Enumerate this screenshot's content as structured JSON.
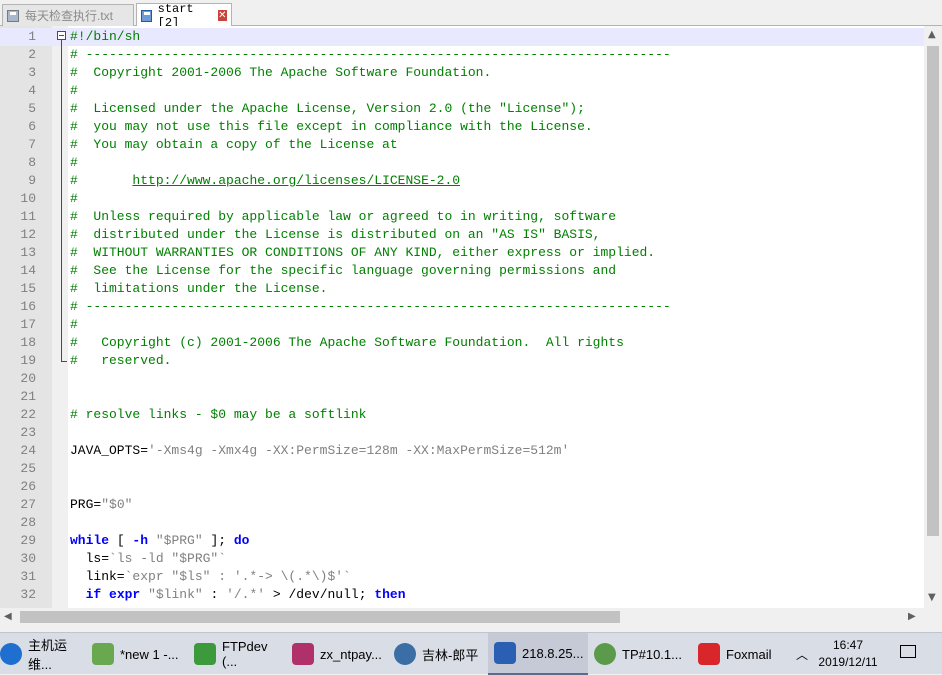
{
  "tabs": [
    {
      "label": "每天检查执行.txt",
      "active": false
    },
    {
      "label": "start [2]",
      "active": true
    }
  ],
  "editor": {
    "current_line": 1,
    "lines": [
      {
        "n": "1",
        "parts": [
          [
            "#!/bin/sh",
            "c"
          ]
        ]
      },
      {
        "n": "2",
        "parts": [
          [
            "# ---------------------------------------------------------------------------",
            "c"
          ]
        ]
      },
      {
        "n": "3",
        "parts": [
          [
            "#  Copyright 2001-2006 The Apache Software Foundation.",
            "c"
          ]
        ]
      },
      {
        "n": "4",
        "parts": [
          [
            "#",
            "c"
          ]
        ]
      },
      {
        "n": "5",
        "parts": [
          [
            "#  Licensed under the Apache License, Version 2.0 (the \"License\");",
            "c"
          ]
        ]
      },
      {
        "n": "6",
        "parts": [
          [
            "#  you may not use this file except in compliance with the License.",
            "c"
          ]
        ]
      },
      {
        "n": "7",
        "parts": [
          [
            "#  You may obtain a copy of the License at",
            "c"
          ]
        ]
      },
      {
        "n": "8",
        "parts": [
          [
            "#",
            "c"
          ]
        ]
      },
      {
        "n": "9",
        "parts": [
          [
            "#       ",
            "c"
          ],
          [
            "http://www.apache.org/licenses/LICENSE-2.0",
            "u"
          ]
        ]
      },
      {
        "n": "10",
        "parts": [
          [
            "#",
            "c"
          ]
        ]
      },
      {
        "n": "11",
        "parts": [
          [
            "#  Unless required by applicable law or agreed to in writing, software",
            "c"
          ]
        ]
      },
      {
        "n": "12",
        "parts": [
          [
            "#  distributed under the License is distributed on an \"AS IS\" BASIS,",
            "c"
          ]
        ]
      },
      {
        "n": "13",
        "parts": [
          [
            "#  WITHOUT WARRANTIES OR CONDITIONS OF ANY KIND, either express or implied.",
            "c"
          ]
        ]
      },
      {
        "n": "14",
        "parts": [
          [
            "#  See the License for the specific language governing permissions and",
            "c"
          ]
        ]
      },
      {
        "n": "15",
        "parts": [
          [
            "#  limitations under the License.",
            "c"
          ]
        ]
      },
      {
        "n": "16",
        "parts": [
          [
            "# ---------------------------------------------------------------------------",
            "c"
          ]
        ]
      },
      {
        "n": "17",
        "parts": [
          [
            "#",
            "c"
          ]
        ]
      },
      {
        "n": "18",
        "parts": [
          [
            "#   Copyright (c) 2001-2006 The Apache Software Foundation.  All rights",
            "c"
          ]
        ]
      },
      {
        "n": "19",
        "parts": [
          [
            "#   reserved.",
            "c"
          ]
        ]
      },
      {
        "n": "20",
        "parts": []
      },
      {
        "n": "21",
        "parts": []
      },
      {
        "n": "22",
        "parts": [
          [
            "# resolve links - $0 may be a softlink",
            "c"
          ]
        ]
      },
      {
        "n": "23",
        "parts": []
      },
      {
        "n": "24",
        "parts": [
          [
            "JAVA_OPTS=",
            ""
          ],
          [
            "'-Xms4g -Xmx4g -XX:PermSize=128m -XX:MaxPermSize=512m'",
            "s"
          ]
        ]
      },
      {
        "n": "25",
        "parts": []
      },
      {
        "n": "26",
        "parts": []
      },
      {
        "n": "27",
        "parts": [
          [
            "PRG=",
            ""
          ],
          [
            "\"$0\"",
            "s"
          ]
        ]
      },
      {
        "n": "28",
        "parts": []
      },
      {
        "n": "29",
        "parts": [
          [
            "while",
            "k"
          ],
          [
            " [ ",
            ""
          ],
          [
            "-h",
            "k"
          ],
          [
            " ",
            ""
          ],
          [
            "\"$PRG\"",
            "s"
          ],
          [
            " ]; ",
            ""
          ],
          [
            "do",
            "k"
          ]
        ]
      },
      {
        "n": "30",
        "parts": [
          [
            "  ls=",
            ""
          ],
          [
            "`ls -ld \"$PRG\"`",
            "s"
          ]
        ]
      },
      {
        "n": "31",
        "parts": [
          [
            "  link=",
            ""
          ],
          [
            "`expr \"$ls\" : '.*-> \\(.*\\)$'`",
            "s"
          ]
        ]
      },
      {
        "n": "32",
        "parts": [
          [
            "  ",
            ""
          ],
          [
            "if",
            "k"
          ],
          [
            " ",
            ""
          ],
          [
            "expr",
            "k"
          ],
          [
            " ",
            ""
          ],
          [
            "\"$link\"",
            "s"
          ],
          [
            " : ",
            ""
          ],
          [
            "'/.*'",
            "s"
          ],
          [
            " > /dev/null; ",
            ""
          ],
          [
            "then",
            "k"
          ]
        ]
      }
    ]
  },
  "taskbar": {
    "items": [
      {
        "label": "主机运维...",
        "icon": "ie-icon",
        "color": "#1f6fd0"
      },
      {
        "label": "*new 1 -...",
        "icon": "notepadpp-icon",
        "color": "#6aa84f"
      },
      {
        "label": "FTPdev (...",
        "icon": "ftp-icon",
        "color": "#3c9a3c"
      },
      {
        "label": "zx_ntpay...",
        "icon": "db-icon",
        "color": "#b0306a"
      },
      {
        "label": "吉林-郎平",
        "icon": "chat-icon",
        "color": "#3a6ea5"
      },
      {
        "label": "218.8.25...",
        "icon": "remote-desktop-icon",
        "color": "#2b5fb3"
      },
      {
        "label": "TP#10.1...",
        "icon": "bdp-icon",
        "color": "#5a9a4a"
      },
      {
        "label": "Foxmail",
        "icon": "foxmail-icon",
        "color": "#d8262a"
      }
    ],
    "active_index": 5,
    "clock_time": "16:47",
    "clock_date": "2019/12/11"
  }
}
